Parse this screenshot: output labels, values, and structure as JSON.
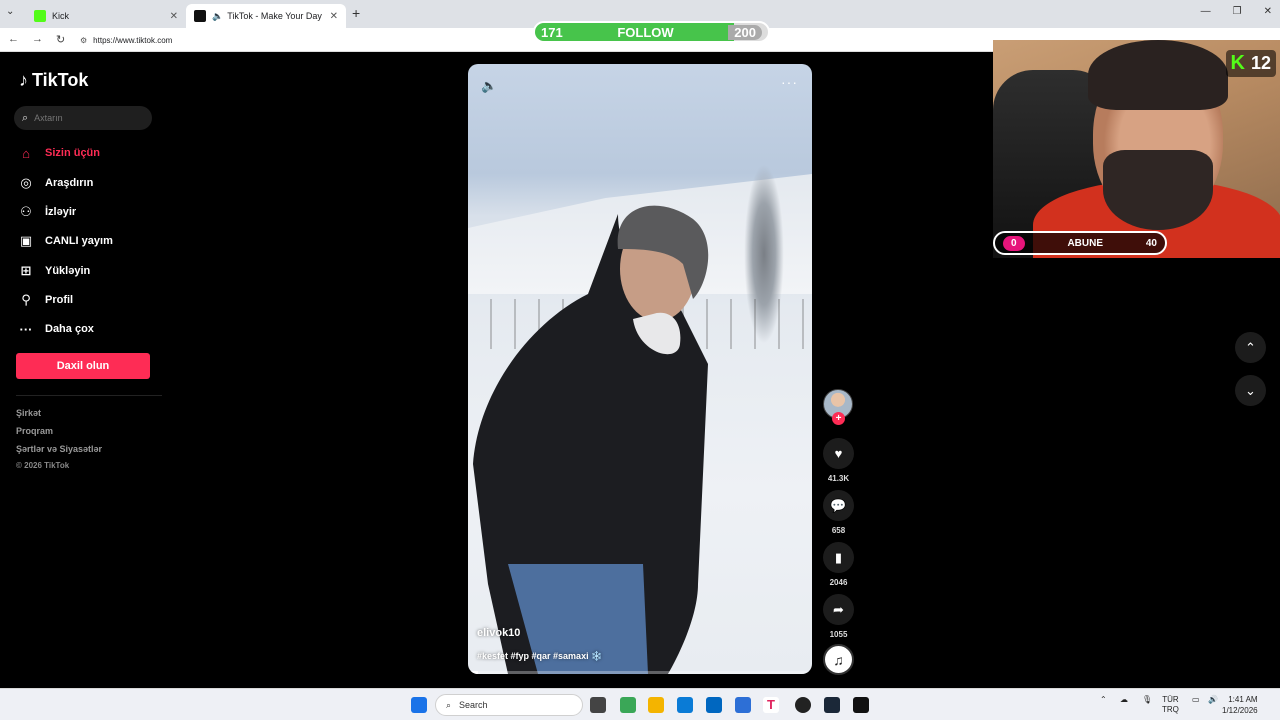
{
  "browser": {
    "tabs": [
      {
        "title": "Kick",
        "active": false,
        "icon": "kick-icon",
        "icon_color": "#53fc18"
      },
      {
        "title": "TikTok - Make Your Day",
        "active": true,
        "icon": "tiktok-icon",
        "icon_color": "#000000"
      }
    ],
    "url": "https://www.tiktok.com"
  },
  "follow_goal": {
    "current": "171",
    "label": "FOLLOW",
    "target": "200",
    "fill_fraction": 0.855,
    "color": "#47c44b"
  },
  "sidebar": {
    "logo": "TikTok",
    "search_placeholder": "Axtarın",
    "nav": [
      {
        "label": "Sizin üçün",
        "icon": "home-icon",
        "active": true
      },
      {
        "label": "Araşdırın",
        "icon": "compass-icon",
        "active": false
      },
      {
        "label": "İzləyir",
        "icon": "following-icon",
        "active": false
      },
      {
        "label": "CANLI yayım",
        "icon": "live-icon",
        "active": false
      },
      {
        "label": "Yükləyin",
        "icon": "upload-icon",
        "active": false
      },
      {
        "label": "Profil",
        "icon": "profile-icon",
        "active": false
      },
      {
        "label": "Daha çox",
        "icon": "more-icon",
        "active": false
      }
    ],
    "login_label": "Daxil olun",
    "footer_links": [
      "Şirkət",
      "Proqram",
      "Şərtlər və Siyasətlər"
    ],
    "copyright": "© 2026 TikTok",
    "accent_color": "#fe2c55"
  },
  "video": {
    "username": "elivok10",
    "caption": "#kesfet #fyp #qar #samaxi ❄️",
    "progress_fraction": 0.03
  },
  "actions": {
    "likes": "41.3K",
    "comments": "658",
    "saves": "2046",
    "shares": "1055"
  },
  "webcam_overlay": {
    "kick_count": "12",
    "abune_current": "0",
    "abune_label": "ABUNE",
    "abune_target": "40",
    "kick_color": "#53fc18",
    "abune_color": "#e6157b"
  },
  "taskbar": {
    "search_label": "Search",
    "lang": "TÜR",
    "lang2": "TRQ",
    "time": "1:41 AM",
    "date": "1/12/2026"
  }
}
